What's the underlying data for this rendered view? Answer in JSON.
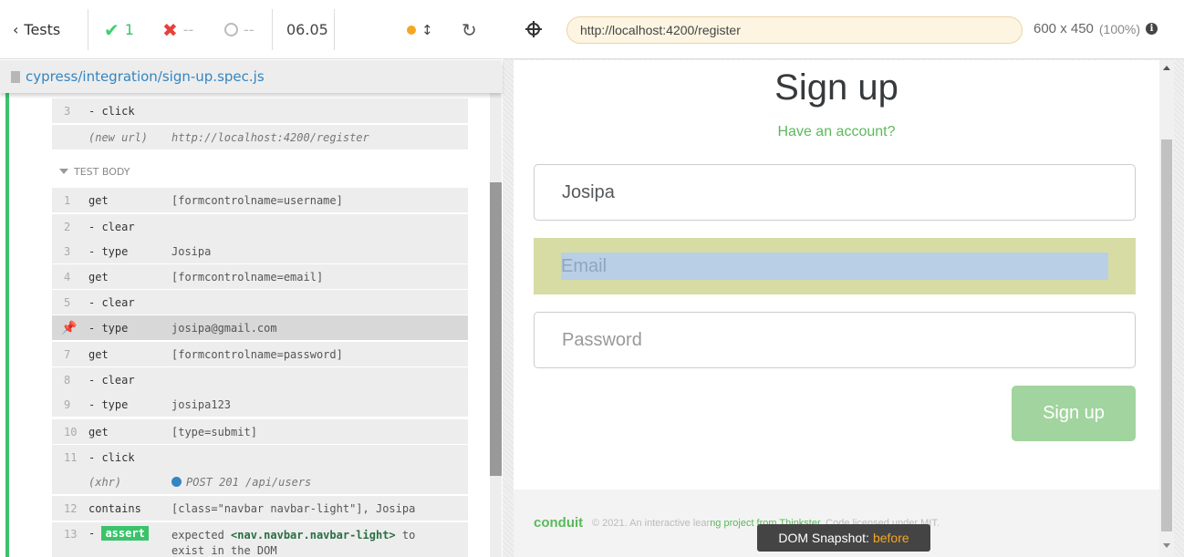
{
  "runner": {
    "tests_label": "Tests",
    "passed": "1",
    "failed": "--",
    "pending": "--",
    "duration": "06.05",
    "spec_file": "cypress/integration/sign-up.spec.js"
  },
  "commands_pre": [
    {
      "n": "3",
      "name": "- click",
      "msg": ""
    },
    {
      "n": "",
      "name": "(new url)",
      "msg": "http://localhost:4200/register"
    }
  ],
  "test_body_label": "TEST BODY",
  "commands": [
    {
      "n": "1",
      "name": "get",
      "msg": "[formcontrolname=username]"
    },
    {
      "n": "2",
      "name": "- clear",
      "msg": ""
    },
    {
      "n": "3",
      "name": "- type",
      "msg": "Josipa"
    },
    {
      "n": "4",
      "name": "get",
      "msg": "[formcontrolname=email]"
    },
    {
      "n": "5",
      "name": "- clear",
      "msg": ""
    },
    {
      "n": "",
      "name": "- type",
      "msg": "josipa@gmail.com"
    },
    {
      "n": "7",
      "name": "get",
      "msg": "[formcontrolname=password]"
    },
    {
      "n": "8",
      "name": "- clear",
      "msg": ""
    },
    {
      "n": "9",
      "name": "- type",
      "msg": "josipa123"
    },
    {
      "n": "10",
      "name": "get",
      "msg": "[type=submit]"
    },
    {
      "n": "11",
      "name": "- click",
      "msg": ""
    },
    {
      "n": "",
      "name": "(xhr)",
      "msg": "POST 201 /api/users"
    },
    {
      "n": "12",
      "name": "contains",
      "msg": "[class=\"navbar navbar-light\"], Josipa"
    },
    {
      "n": "13",
      "name": "- assert",
      "msg": "expected",
      "msg_code": "<nav.navbar.navbar-light>",
      "msg_tail": "to",
      "msg_line2": "exist in the DOM"
    }
  ],
  "browser": {
    "url": "http://localhost:4200/register",
    "viewport": "600 x 450",
    "zoom": "(100%)"
  },
  "app": {
    "title": "Sign up",
    "have_account": "Have an account?",
    "username_value": "Josipa",
    "email_placeholder": "Email",
    "password_placeholder": "Password",
    "submit_label": "Sign up",
    "brand": "conduit",
    "footer_pre": "© 2021. An interactive lear",
    "footer_link": "ng project from Thinkster.",
    "footer_post": " Code licensed under MIT."
  },
  "snapshot": {
    "label": "DOM Snapshot:",
    "state": "before"
  },
  "colors": {
    "pass": "#3bc36b",
    "fail": "#e7403a",
    "brand": "#5cb85c",
    "submit": "#a1d49e"
  }
}
